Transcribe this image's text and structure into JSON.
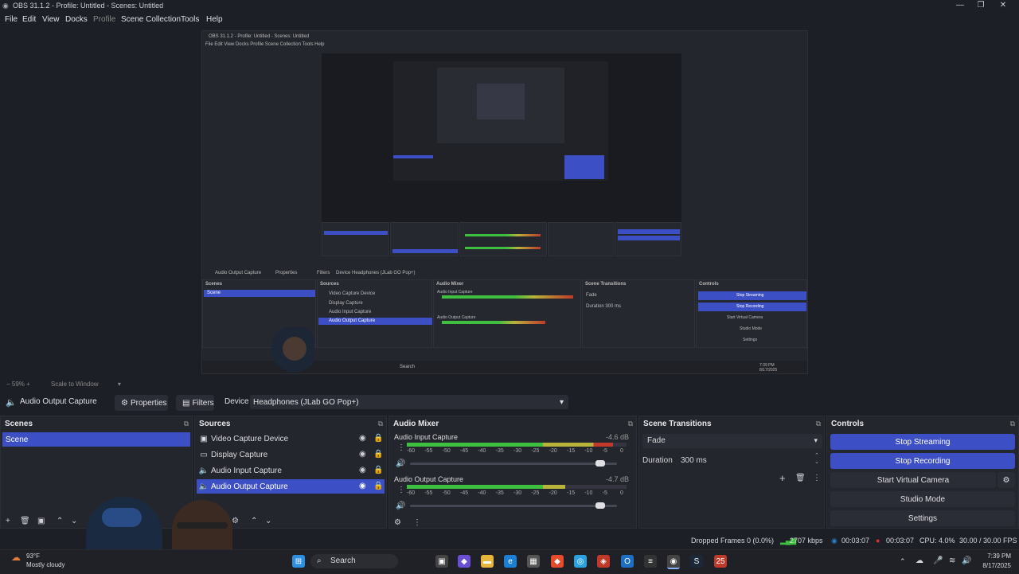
{
  "app": {
    "title": "OBS 31.1.2 - Profile: Untitled - Scenes: Untitled",
    "window_controls": {
      "minimize": "—",
      "maximize": "❐",
      "close": "✕"
    }
  },
  "menu": [
    "File",
    "Edit",
    "View",
    "Docks",
    "Profile",
    "Scene Collection",
    "Tools",
    "Help"
  ],
  "menu_dim_index": 4,
  "preview": {
    "zoom": "59%",
    "scale_mode": "Scale to Window"
  },
  "context_bar": {
    "source_name": "Audio Output Capture",
    "properties_label": "Properties",
    "filters_label": "Filters",
    "device_label": "Device",
    "device_value": "Headphones (JLab GO Pop+)"
  },
  "scenes": {
    "title": "Scenes",
    "items": [
      "Scene"
    ]
  },
  "sources": {
    "title": "Sources",
    "items": [
      {
        "name": "Video Capture Device",
        "icon": "camera-icon"
      },
      {
        "name": "Display Capture",
        "icon": "monitor-icon"
      },
      {
        "name": "Audio Input Capture",
        "icon": "speaker-icon"
      },
      {
        "name": "Audio Output Capture",
        "icon": "speaker-icon"
      }
    ]
  },
  "audio_mixer": {
    "title": "Audio Mixer",
    "channels": [
      {
        "name": "Audio Input Capture",
        "db": "-4.6 dB",
        "level": 0.94,
        "volume": 0.92
      },
      {
        "name": "Audio Output Capture",
        "db": "-4.7 dB",
        "level": 0.72,
        "volume": 0.92
      }
    ],
    "scale": [
      "-60",
      "-55",
      "-50",
      "-45",
      "-40",
      "-35",
      "-30",
      "-25",
      "-20",
      "-15",
      "-10",
      "-5",
      "0"
    ]
  },
  "scene_transitions": {
    "title": "Scene Transitions",
    "transition": "Fade",
    "duration_label": "Duration",
    "duration_value": "300 ms"
  },
  "controls": {
    "title": "Controls",
    "stop_streaming": "Stop Streaming",
    "stop_recording": "Stop Recording",
    "start_virtual_camera": "Start Virtual Camera",
    "studio_mode": "Studio Mode",
    "settings": "Settings"
  },
  "status": {
    "dropped_frames": "Dropped Frames 0 (0.0%)",
    "bitrate": "2707 kbps",
    "stream_time": "00:03:07",
    "rec_time": "00:03:07",
    "cpu": "CPU: 4.0%",
    "fps": "30.00 / 30.00 FPS"
  },
  "taskbar": {
    "weather_temp": "93°F",
    "weather_desc": "Mostly cloudy",
    "search": "Search",
    "time": "7:39 PM",
    "date": "8/17/2025"
  },
  "colors": {
    "accent": "#3d4fc4",
    "meter_green": "#3fbf3f",
    "meter_yellow": "#b8b33a",
    "meter_red": "#c0392b",
    "rec_red": "#e0302a",
    "stream_blue": "#2e7cc4"
  }
}
